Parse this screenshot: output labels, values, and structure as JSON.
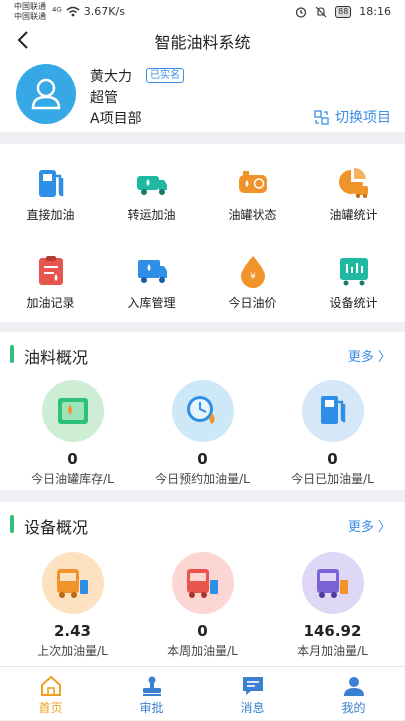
{
  "status_bar": {
    "carrier_1": "中国联通",
    "carrier_2": "中国联通",
    "signal": "⁴ᴳ",
    "speed": "3.67K/s",
    "battery": "88",
    "time": "18:16"
  },
  "nav": {
    "title": "智能油料系统",
    "back_icon": "chevron-left-icon"
  },
  "profile": {
    "name": "黄大力",
    "verified_badge": "已实名",
    "role": "超管",
    "department": "A项目部",
    "switch_label": "切换项目"
  },
  "menu": [
    {
      "label": "直接加油",
      "icon": "fuel-pump-icon",
      "color": "#2f8ee6"
    },
    {
      "label": "转运加油",
      "icon": "tanker-truck-icon",
      "color": "#1fb8a0"
    },
    {
      "label": "油罐状态",
      "icon": "tank-status-icon",
      "color": "#f0932b"
    },
    {
      "label": "油罐统计",
      "icon": "tank-stats-icon",
      "color": "#f0932b"
    },
    {
      "label": "加油记录",
      "icon": "fuel-record-icon",
      "color": "#e8554e"
    },
    {
      "label": "入库管理",
      "icon": "warehouse-truck-icon",
      "color": "#2f8ee6"
    },
    {
      "label": "今日油价",
      "icon": "oil-price-icon",
      "color": "#f0932b"
    },
    {
      "label": "设备统计",
      "icon": "device-stats-icon",
      "color": "#1fb8a0"
    }
  ],
  "oil_overview": {
    "title": "油料概况",
    "more": "更多 〉",
    "stats": [
      {
        "value": "0",
        "caption": "今日油罐库存/L",
        "icon": "tank-stock-icon",
        "bg": "#cdeed5"
      },
      {
        "value": "0",
        "caption": "今日预约加油量/L",
        "icon": "clock-fuel-icon",
        "bg": "#cde9f7"
      },
      {
        "value": "0",
        "caption": "今日已加油量/L",
        "icon": "fuel-pump-icon",
        "bg": "#d6e8f8"
      }
    ]
  },
  "equipment_overview": {
    "title": "设备概况",
    "more": "更多 〉",
    "stats": [
      {
        "value": "2.43",
        "caption": "上次加油量/L",
        "icon": "truck-fuel-icon",
        "bg": "#fde2c2"
      },
      {
        "value": "0",
        "caption": "本周加油量/L",
        "icon": "truck-fuel-icon",
        "bg": "#fcd6d2"
      },
      {
        "value": "146.92",
        "caption": "本月加油量/L",
        "icon": "truck-fuel-icon",
        "bg": "#ded8f6"
      }
    ]
  },
  "tabs": [
    {
      "label": "首页",
      "icon": "home-icon",
      "active": true
    },
    {
      "label": "审批",
      "icon": "stamp-icon",
      "active": false
    },
    {
      "label": "消息",
      "icon": "message-icon",
      "active": false
    },
    {
      "label": "我的",
      "icon": "user-icon",
      "active": false
    }
  ],
  "colors": {
    "primary": "#3a8ee6",
    "accent": "#2fc17a",
    "active_tab": "#f0a020"
  }
}
